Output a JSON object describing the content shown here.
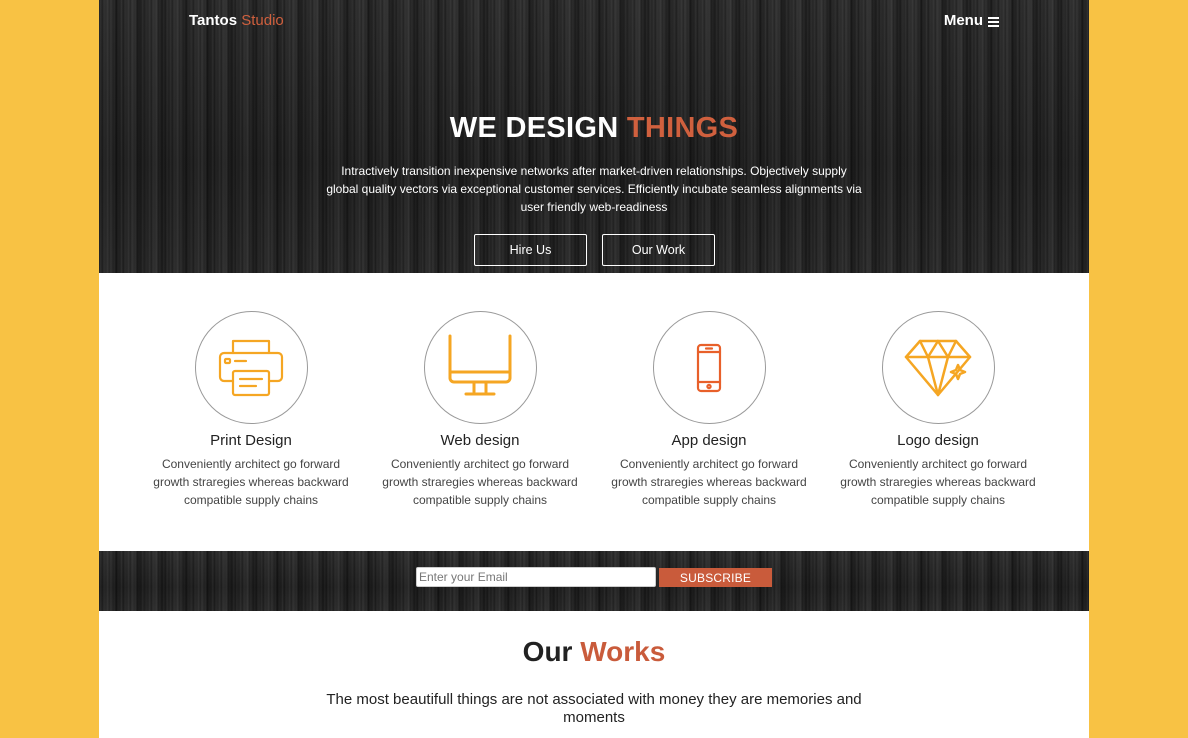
{
  "header": {
    "brand_main": "Tantos",
    "brand_accent": "Studio",
    "menu_label": "Menu",
    "menu_icon": "hamburger-icon"
  },
  "hero": {
    "title_main": "WE DESIGN",
    "title_accent": "THINGS",
    "text": "Intractively transition inexpensive networks after market-driven relationships. Objectively supply global quality vectors via exceptional customer services. Efficiently incubate seamless alignments via user friendly web-readiness",
    "hire_label": "Hire Us",
    "work_label": "Our Work"
  },
  "services": [
    {
      "icon": "printer-icon",
      "title": "Print Design",
      "desc": "Conveniently architect go forward growth straregies whereas backward compatible supply chains"
    },
    {
      "icon": "monitor-icon",
      "title": "Web design",
      "desc": "Conveniently architect go forward growth straregies whereas backward compatible supply chains"
    },
    {
      "icon": "smartphone-icon",
      "title": "App design",
      "desc": "Conveniently architect go forward growth straregies whereas backward compatible supply chains"
    },
    {
      "icon": "diamond-icon",
      "title": "Logo design",
      "desc": "Conveniently architect go forward growth straregies whereas backward compatible supply chains"
    }
  ],
  "subscribe": {
    "placeholder": "Enter your Email",
    "button_label": "SUBSCRIBE"
  },
  "works": {
    "title_main": "Our",
    "title_accent": "Works",
    "subtitle": "The most beautifull things are not associated with money they are memories and moments"
  },
  "colors": {
    "accent": "#d0603e",
    "icon_orange": "#f5a623",
    "page_bg": "#f8c244",
    "hero_bg": "#1c1c1c"
  }
}
